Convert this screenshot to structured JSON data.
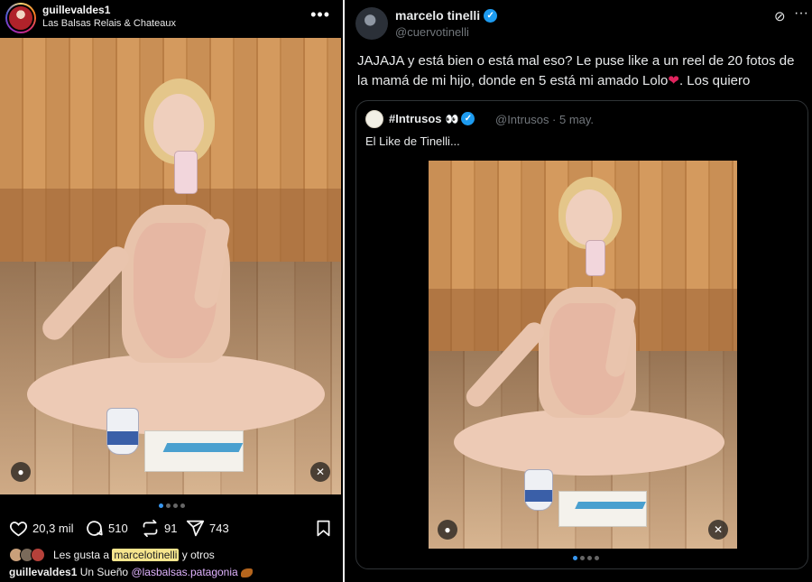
{
  "instagram": {
    "username": "guillevaldes1",
    "location": "Las Balsas Relais & Chateaux",
    "more_icon": "more-horizontal-icon",
    "likes_count": "20,3 mil",
    "comments_count": "510",
    "reposts_count": "91",
    "shares_count": "743",
    "liked_by_prefix": "Les gusta a",
    "liked_by_user": "marcelotinelli",
    "liked_by_suffix": "y otros",
    "caption_user": "guillevaldes1",
    "caption_text": "Un Sueño",
    "caption_mention": "@lasbalsas.patagonia",
    "carousel_dots": 4,
    "carousel_active": 1,
    "icons": [
      "heart-icon",
      "comment-icon",
      "repost-icon",
      "send-icon",
      "bookmark-icon",
      "user-tag-icon",
      "mute-icon"
    ]
  },
  "twitter": {
    "display_name": "marcelo tinelli",
    "handle": "@cuervotinelli",
    "tweet_text": "JAJAJA y está bien o está mal eso? Le puse like a un reel de 20 fotos de la mamá de mi hijo, donde en 5 está mi amado Lolo",
    "tweet_text_end": ". Los quiero",
    "heart_emoji": "❤",
    "grok_icon": "grok-icon",
    "quote": {
      "name": "#Intrusos",
      "eyes_emoji": "👀",
      "handle_date": "@Intrusos · 5 may.",
      "text": "El Like de Tinelli..."
    },
    "carousel_dots": 4,
    "carousel_active": 1
  },
  "colors": {
    "verified_blue": "#1d9bf0",
    "instagram_dot_active": "#3897f0",
    "mention_highlight": "#f6e58d"
  }
}
